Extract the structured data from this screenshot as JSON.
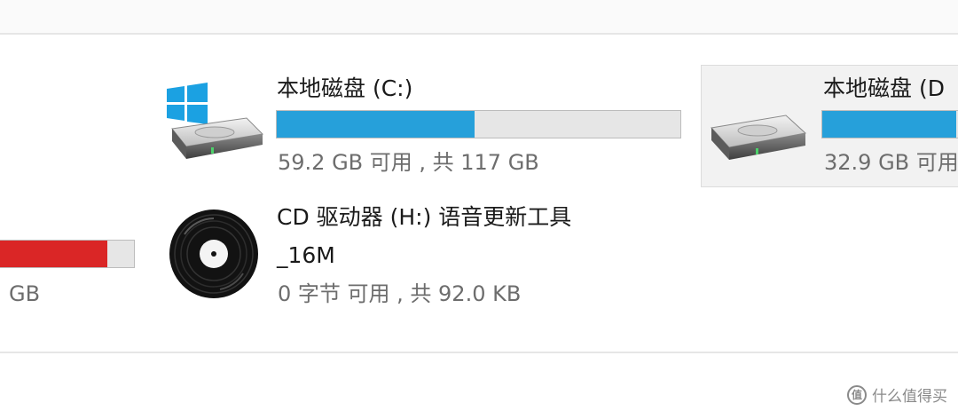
{
  "drives": [
    {
      "id": "c",
      "label": "本地磁盘 (C:)",
      "usage_text": "59.2 GB 可用 , 共 117 GB",
      "used_fraction": 0.49,
      "bar_color": "#26a0da"
    },
    {
      "id": "d",
      "label": "本地磁盘 (D",
      "usage_text": "32.9 GB 可用",
      "used_fraction": 0.9,
      "bar_color": "#26a0da"
    },
    {
      "id": "left",
      "usage_text": "GB",
      "used_fraction": 0.8,
      "bar_color": "#da2626"
    }
  ],
  "cd_drive": {
    "label_line1": "CD 驱动器 (H:) 语音更新工具",
    "label_line2": "_16M",
    "usage_text": "0 字节 可用 , 共 92.0 KB"
  },
  "watermark": {
    "text": "什么值得买",
    "logo_text": "值"
  },
  "icons": {
    "c_drive": "windows-hard-drive-icon",
    "d_drive": "hard-drive-icon",
    "cd_drive": "disc-icon"
  }
}
